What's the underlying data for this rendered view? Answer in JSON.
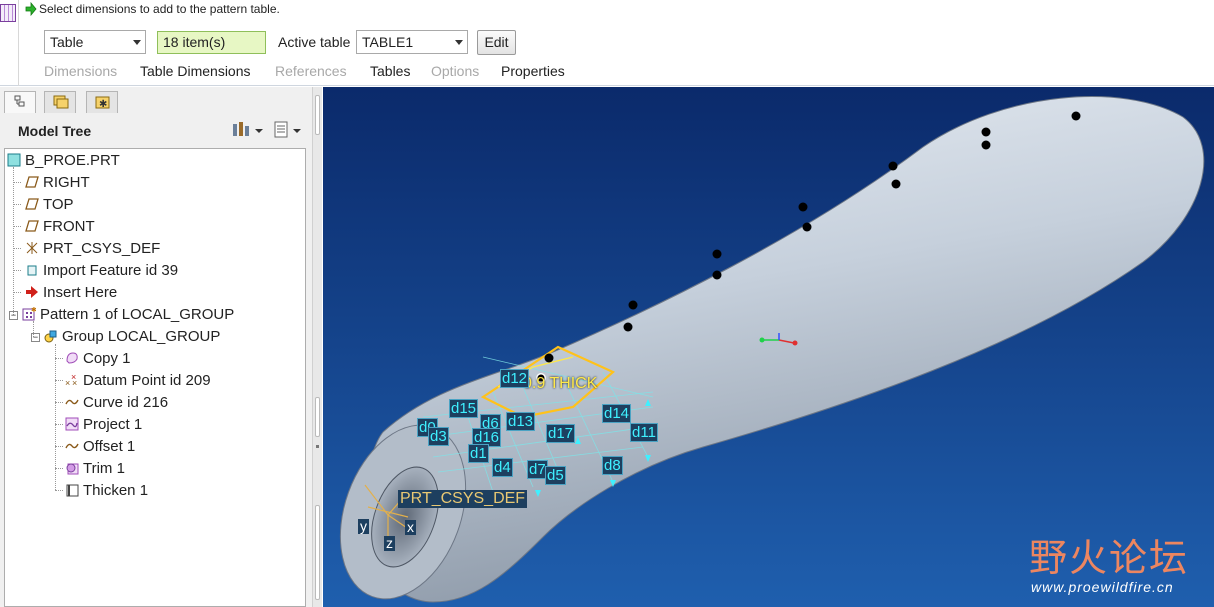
{
  "dashboard": {
    "message": "Select dimensions to add to the pattern table.",
    "pattern_type": "Table",
    "item_count": "18 item(s)",
    "active_table_label": "Active table",
    "active_table_value": "TABLE1",
    "edit_label": "Edit",
    "tabs": [
      {
        "label": "Dimensions",
        "enabled": false
      },
      {
        "label": "Table Dimensions",
        "enabled": true
      },
      {
        "label": "References",
        "enabled": false
      },
      {
        "label": "Tables",
        "enabled": true
      },
      {
        "label": "Options",
        "enabled": false
      },
      {
        "label": "Properties",
        "enabled": true
      }
    ]
  },
  "navigator": {
    "title": "Model Tree",
    "tree": [
      {
        "label": "B_PROE.PRT",
        "icon": "part-icon"
      },
      {
        "label": "RIGHT",
        "icon": "datum-plane-icon"
      },
      {
        "label": "TOP",
        "icon": "datum-plane-icon"
      },
      {
        "label": "FRONT",
        "icon": "datum-plane-icon"
      },
      {
        "label": "PRT_CSYS_DEF",
        "icon": "csys-icon"
      },
      {
        "label": "Import Feature id 39",
        "icon": "import-feature-icon"
      },
      {
        "label": "Insert Here",
        "icon": "insert-here-arrow-icon"
      },
      {
        "label": "Pattern 1 of LOCAL_GROUP",
        "icon": "pattern-icon"
      },
      {
        "label": "Group LOCAL_GROUP",
        "icon": "group-icon"
      },
      {
        "label": "Copy 1",
        "icon": "copy-icon"
      },
      {
        "label": "Datum Point id 209",
        "icon": "datum-point-icon"
      },
      {
        "label": "Curve id 216",
        "icon": "curve-icon"
      },
      {
        "label": "Project 1",
        "icon": "project-icon"
      },
      {
        "label": "Offset 1",
        "icon": "offset-icon"
      },
      {
        "label": "Trim 1",
        "icon": "trim-icon"
      },
      {
        "label": "Thicken 1",
        "icon": "thicken-icon"
      }
    ]
  },
  "graphics": {
    "dimensions": [
      "d12",
      "d15",
      "d6",
      "d13",
      "d0",
      "d3",
      "d16",
      "d17",
      "d14",
      "d11",
      "d1",
      "d4",
      "d7",
      "d5",
      "d8"
    ],
    "feature_label": "0.9 THICK",
    "csys_label": "PRT_CSYS_DEF",
    "axes": [
      "y",
      "z",
      "x"
    ],
    "colors": {
      "background_top": "#0b2a6b",
      "background_bottom": "#1f5fae",
      "part": "#c9d3df",
      "dimension": "#3ff0ff",
      "highlight": "#ffd21a"
    }
  },
  "watermark": {
    "title": "野火论坛",
    "url": "www.proewildfire.cn"
  }
}
